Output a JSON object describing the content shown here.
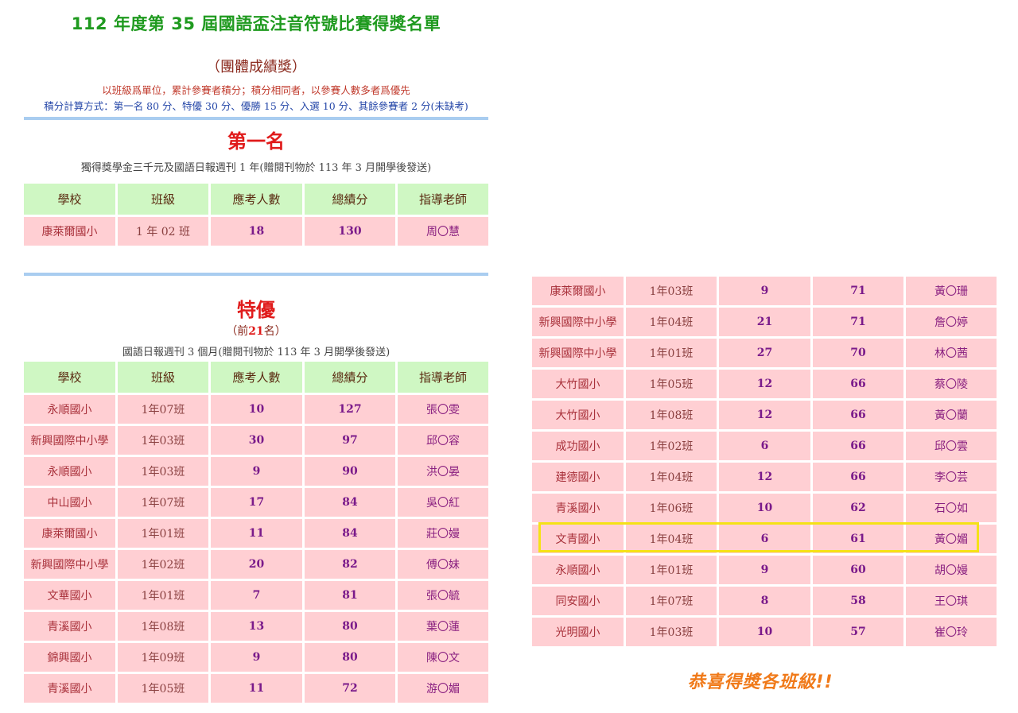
{
  "title": "112 年度第 35 屆國語盃注音符號比賽得獎名單",
  "subtitle": "（團體成績獎）",
  "rules": {
    "line1": "以班級爲單位，累計參賽者積分；積分相同者，以參賽人數多者爲優先",
    "line2": "積分計算方式：第一名 80 分、特優 30 分、優勝 15 分、入選 10 分、其餘參賽者 2 分(未缺考)"
  },
  "headers": [
    "學校",
    "班級",
    "應考人數",
    "總績分",
    "指導老師"
  ],
  "first_place": {
    "title": "第一名",
    "note": "獨得獎學金三千元及國語日報週刊 1 年(贈閱刊物於 113 年 3 月開學後發送)",
    "rows": [
      {
        "school": "康萊爾國小",
        "class": "1 年 02 班",
        "count": "18",
        "score": "130",
        "teacher": "周〇慧"
      }
    ]
  },
  "special": {
    "title": "特優",
    "top_prefix": "（前",
    "top_n": "21",
    "top_suffix": "名）",
    "note": "國語日報週刊 3 個月(贈閱刊物於 113 年 3 月開學後發送)",
    "rows": [
      {
        "school": "永順國小",
        "class": "1年07班",
        "count": "10",
        "score": "127",
        "teacher": "張〇雯"
      },
      {
        "school": "新興國際中小學",
        "class": "1年03班",
        "count": "30",
        "score": "97",
        "teacher": "邱〇容"
      },
      {
        "school": "永順國小",
        "class": "1年03班",
        "count": "9",
        "score": "90",
        "teacher": "洪〇晏"
      },
      {
        "school": "中山國小",
        "class": "1年07班",
        "count": "17",
        "score": "84",
        "teacher": "吳〇紅"
      },
      {
        "school": "康萊爾國小",
        "class": "1年01班",
        "count": "11",
        "score": "84",
        "teacher": "莊〇嫚"
      },
      {
        "school": "新興國際中小學",
        "class": "1年02班",
        "count": "20",
        "score": "82",
        "teacher": "傅〇妹"
      },
      {
        "school": "文華國小",
        "class": "1年01班",
        "count": "7",
        "score": "81",
        "teacher": "張〇毓"
      },
      {
        "school": "青溪國小",
        "class": "1年08班",
        "count": "13",
        "score": "80",
        "teacher": "葉〇蓮"
      },
      {
        "school": "錦興國小",
        "class": "1年09班",
        "count": "9",
        "score": "80",
        "teacher": "陳〇文"
      },
      {
        "school": "青溪國小",
        "class": "1年05班",
        "count": "11",
        "score": "72",
        "teacher": "游〇媚"
      }
    ],
    "rows_continued": [
      {
        "school": "康萊爾國小",
        "class": "1年03班",
        "count": "9",
        "score": "71",
        "teacher": "黃〇珊"
      },
      {
        "school": "新興國際中小學",
        "class": "1年04班",
        "count": "21",
        "score": "71",
        "teacher": "詹〇婷"
      },
      {
        "school": "新興國際中小學",
        "class": "1年01班",
        "count": "27",
        "score": "70",
        "teacher": "林〇茜"
      },
      {
        "school": "大竹國小",
        "class": "1年05班",
        "count": "12",
        "score": "66",
        "teacher": "蔡〇陵"
      },
      {
        "school": "大竹國小",
        "class": "1年08班",
        "count": "12",
        "score": "66",
        "teacher": "黃〇蘭"
      },
      {
        "school": "成功國小",
        "class": "1年02班",
        "count": "6",
        "score": "66",
        "teacher": "邱〇雲"
      },
      {
        "school": "建德國小",
        "class": "1年04班",
        "count": "12",
        "score": "66",
        "teacher": "李〇芸"
      },
      {
        "school": "青溪國小",
        "class": "1年06班",
        "count": "10",
        "score": "62",
        "teacher": "石〇如"
      },
      {
        "school": "文青國小",
        "class": "1年04班",
        "count": "6",
        "score": "61",
        "teacher": "黃〇媚"
      },
      {
        "school": "永順國小",
        "class": "1年01班",
        "count": "9",
        "score": "60",
        "teacher": "胡〇嫚"
      },
      {
        "school": "同安國小",
        "class": "1年07班",
        "count": "8",
        "score": "58",
        "teacher": "王〇琪"
      },
      {
        "school": "光明國小",
        "class": "1年03班",
        "count": "10",
        "score": "57",
        "teacher": "崔〇玲"
      }
    ]
  },
  "congrats": "恭喜得獎各班級!!",
  "colors": {
    "title_green": "#1f9a1f",
    "section_red": "#e01b1b",
    "header_bg": "#cff7c3",
    "cell_bg": "#ffcfd3",
    "number_purple": "#7a1a8a",
    "highlight_yellow": "#f5e216",
    "divider_blue": "#a9cdf0",
    "congrats_orange": "#f07a1a"
  }
}
